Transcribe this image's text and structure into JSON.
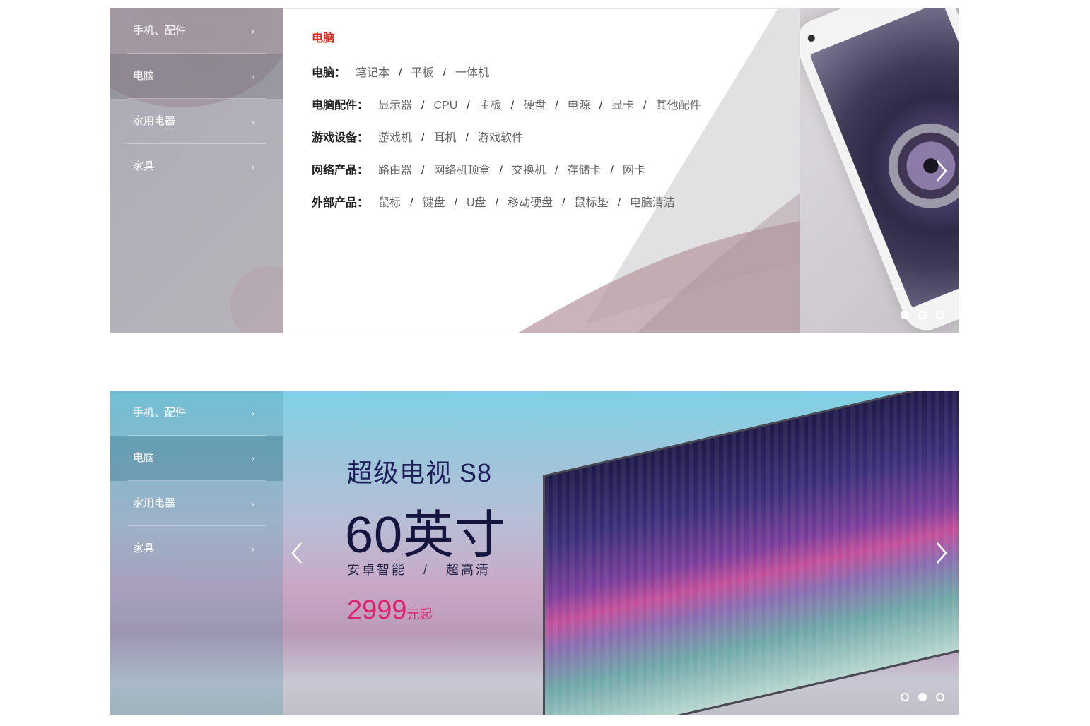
{
  "categories": [
    "手机、配件",
    "电脑",
    "家用电器",
    "家具"
  ],
  "arrow_glyph": "›",
  "banner1": {
    "active_category": 1,
    "panel": {
      "title": "电脑",
      "rows": [
        {
          "label": "电脑：",
          "links": [
            "笔记本",
            "平板",
            "一体机"
          ]
        },
        {
          "label": "电脑配件：",
          "links": [
            "显示器",
            "CPU",
            "主板",
            "硬盘",
            "电源",
            "显卡",
            "其他配件"
          ]
        },
        {
          "label": "游戏设备：",
          "links": [
            "游戏机",
            "耳机",
            "游戏软件"
          ]
        },
        {
          "label": "网络产品：",
          "links": [
            "路由器",
            "网络机顶盒",
            "交换机",
            "存储卡",
            "网卡"
          ]
        },
        {
          "label": "外部产品：",
          "links": [
            "鼠标",
            "键盘",
            "U盘",
            "移动硬盘",
            "鼠标垫",
            "电脑清洁"
          ]
        }
      ],
      "separator": "/"
    },
    "dots": 3,
    "active_dot": 0
  },
  "banner2": {
    "active_category": 1,
    "title": "超级电视 S8",
    "size": "60英寸",
    "subtitle": "安卓智能   /   超高清",
    "price": "2999",
    "price_unit": "元起",
    "dots": 3,
    "active_dot": 1
  },
  "icons": {
    "prev": "chevron-left-icon",
    "next": "chevron-right-icon"
  },
  "colors": {
    "accent_red": "#e1251b",
    "price_pink": "#e0206b"
  }
}
